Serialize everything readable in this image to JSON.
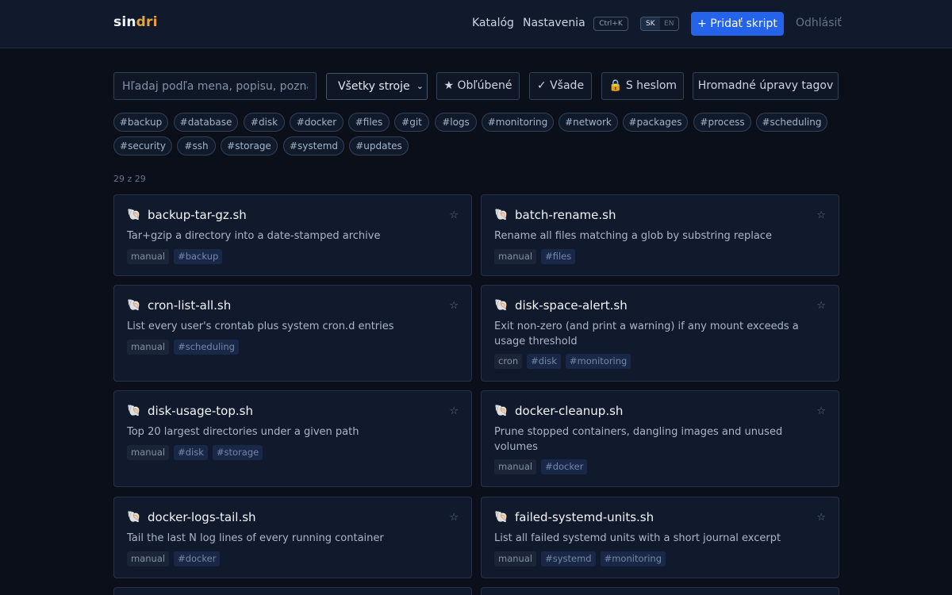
{
  "header": {
    "logo_part1": "sin",
    "logo_part2": "dri",
    "nav": {
      "catalog": "Katalóg",
      "settings": "Nastavenia"
    },
    "shortcut": "Ctrl+K",
    "languages": [
      "SK",
      "EN"
    ],
    "active_language": "SK",
    "add_button": "+ Pridať skript",
    "logout": "Odhlásiť"
  },
  "filters": {
    "search_placeholder": "Hľadaj podľa mena, popisu, poznám",
    "machine_select": "Všetky stroje",
    "favorites": "★ Obľúbené",
    "everywhere": "✓ Všade",
    "password": "🔒 S heslom",
    "bulk_tags": "Hromadné úpravy tagov"
  },
  "tags": [
    "#backup",
    "#database",
    "#disk",
    "#docker",
    "#files",
    "#git",
    "#logs",
    "#monitoring",
    "#network",
    "#packages",
    "#process",
    "#scheduling",
    "#security",
    "#ssh",
    "#storage",
    "#systemd",
    "#updates"
  ],
  "result_count": "29 z 29",
  "scripts": [
    {
      "icon": "🐚",
      "name": "backup-tar-gz.sh",
      "description": "Tar+gzip a directory into a date-stamped archive",
      "trigger": "manual",
      "tags": [
        "#backup"
      ]
    },
    {
      "icon": "🐚",
      "name": "batch-rename.sh",
      "description": "Rename all files matching a glob by substring replace",
      "trigger": "manual",
      "tags": [
        "#files"
      ]
    },
    {
      "icon": "🐚",
      "name": "cron-list-all.sh",
      "description": "List every user's crontab plus system cron.d entries",
      "trigger": "manual",
      "tags": [
        "#scheduling"
      ]
    },
    {
      "icon": "🐚",
      "name": "disk-space-alert.sh",
      "description": "Exit non-zero (and print a warning) if any mount exceeds a usage threshold",
      "trigger": "cron",
      "tags": [
        "#disk",
        "#monitoring"
      ]
    },
    {
      "icon": "🐚",
      "name": "disk-usage-top.sh",
      "description": "Top 20 largest directories under a given path",
      "trigger": "manual",
      "tags": [
        "#disk",
        "#storage"
      ]
    },
    {
      "icon": "🐚",
      "name": "docker-cleanup.sh",
      "description": "Prune stopped containers, dangling images and unused volumes",
      "trigger": "manual",
      "tags": [
        "#docker"
      ]
    },
    {
      "icon": "🐚",
      "name": "docker-logs-tail.sh",
      "description": "Tail the last N log lines of every running container",
      "trigger": "manual",
      "tags": [
        "#docker"
      ]
    },
    {
      "icon": "🐚",
      "name": "failed-systemd-units.sh",
      "description": "List all failed systemd units with a short journal excerpt",
      "trigger": "manual",
      "tags": [
        "#systemd",
        "#monitoring"
      ]
    }
  ],
  "star_icon": "☆",
  "colors": {
    "accent": "#2563eb",
    "logo_highlight": "#e8a33b",
    "background": "#0a0f1a",
    "card": "#111a2c"
  }
}
